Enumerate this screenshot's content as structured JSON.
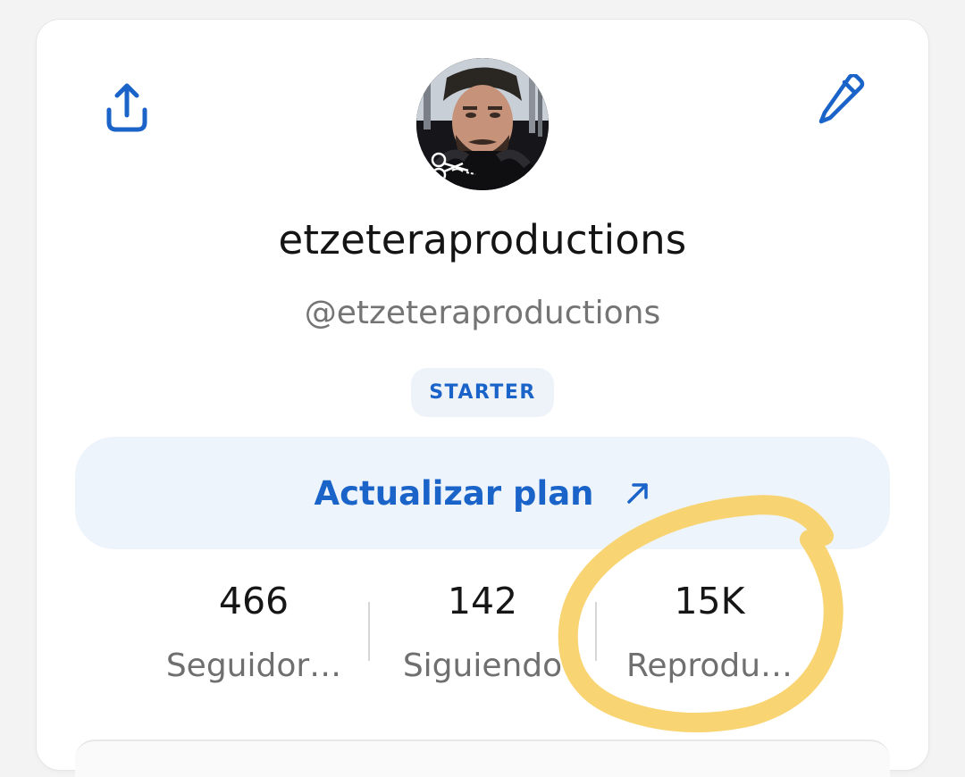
{
  "profile": {
    "display_name": "etzeteraproductions",
    "handle": "@etzeteraproductions",
    "plan_badge": "STARTER"
  },
  "actions": {
    "upgrade_label": "Actualizar plan",
    "share_icon": "share-icon",
    "edit_icon": "pencil-icon",
    "upgrade_icon": "arrow-up-right-icon"
  },
  "stats": [
    {
      "value": "466",
      "label": "Seguidor…"
    },
    {
      "value": "142",
      "label": "Siguiendo"
    },
    {
      "value": "15K",
      "label": "Reprodu…"
    }
  ],
  "colors": {
    "accent": "#1a63c9",
    "badge_bg": "#eef3fa",
    "button_bg": "#eef4fb",
    "annotation": "#f8cf63"
  }
}
